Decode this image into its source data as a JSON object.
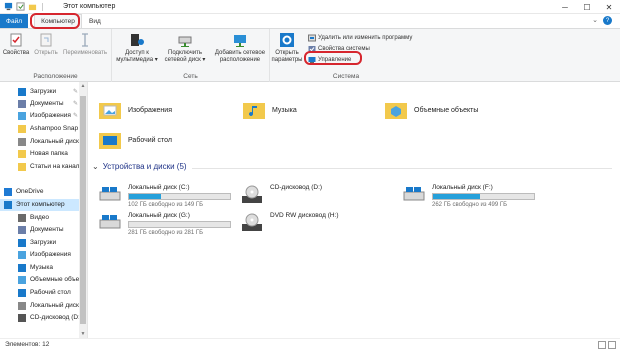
{
  "titlebar": {
    "title": "Этот компьютер",
    "min": "─",
    "max": "☐",
    "close": "✕"
  },
  "tabs": {
    "file": "Файл",
    "computer": "Компьютер",
    "view": "Вид"
  },
  "ribbon": {
    "location": {
      "label": "Расположение",
      "properties": "Свойства",
      "open": "Открыть",
      "rename": "Переименовать"
    },
    "network": {
      "label": "Сеть",
      "media_access": "Доступ к\nмультимедиа ▾",
      "map_drive": "Подключить\nсетевой диск ▾",
      "add_location": "Добавить сетевое\nрасположение"
    },
    "system": {
      "label": "Система",
      "open_settings": "Открыть\nпараметры",
      "uninstall": "Удалить или изменить программу",
      "system_props": "Свойства системы",
      "manage": "Управление"
    }
  },
  "nav": {
    "items": [
      {
        "label": "Загрузки",
        "pinned": true
      },
      {
        "label": "Документы",
        "pinned": true
      },
      {
        "label": "Изображения",
        "pinned": true
      },
      {
        "label": "Ashampoo Snap",
        "pinned": false
      },
      {
        "label": "Локальный диск",
        "pinned": false
      },
      {
        "label": "Новая папка",
        "pinned": false
      },
      {
        "label": "Статьи на канал",
        "pinned": false
      },
      {
        "label": "OneDrive",
        "pinned": false
      },
      {
        "label": "Этот компьютер",
        "pinned": false
      },
      {
        "label": "Видео",
        "pinned": false
      },
      {
        "label": "Документы",
        "pinned": false
      },
      {
        "label": "Загрузки",
        "pinned": false
      },
      {
        "label": "Изображения",
        "pinned": false
      },
      {
        "label": "Музыка",
        "pinned": false
      },
      {
        "label": "Объемные объек",
        "pinned": false
      },
      {
        "label": "Рабочий стол",
        "pinned": false
      },
      {
        "label": "Локальный диск",
        "pinned": false
      },
      {
        "label": "CD-дисковод (D:",
        "pinned": false
      }
    ]
  },
  "folders": {
    "images": "Изображения",
    "music": "Музыка",
    "objects3d": "Объемные объекты",
    "desktop": "Рабочий стол"
  },
  "devices": {
    "header": "Устройства и диски (5)",
    "drives": [
      {
        "name": "Локальный диск (C:)",
        "free": "102 ГБ свободно из 149 ГБ",
        "used_fraction": 0.32
      },
      {
        "name": "CD-дисковод (D:)",
        "free": "",
        "used_fraction": null
      },
      {
        "name": "Локальный диск (F:)",
        "free": "262 ГБ свободно из 499 ГБ",
        "used_fraction": 0.47
      },
      {
        "name": "Локальный диск (G:)",
        "free": "281 ГБ свободно из 281 ГБ",
        "used_fraction": 0.0
      },
      {
        "name": "DVD RW дисковод (H:)",
        "free": "",
        "used_fraction": null
      }
    ]
  },
  "status": {
    "items": "Элементов: 12"
  },
  "colors": {
    "accent": "#1979ca",
    "highlight": "#d6262e",
    "drive_bar": "#26a0da",
    "selection": "#cce8ff"
  }
}
